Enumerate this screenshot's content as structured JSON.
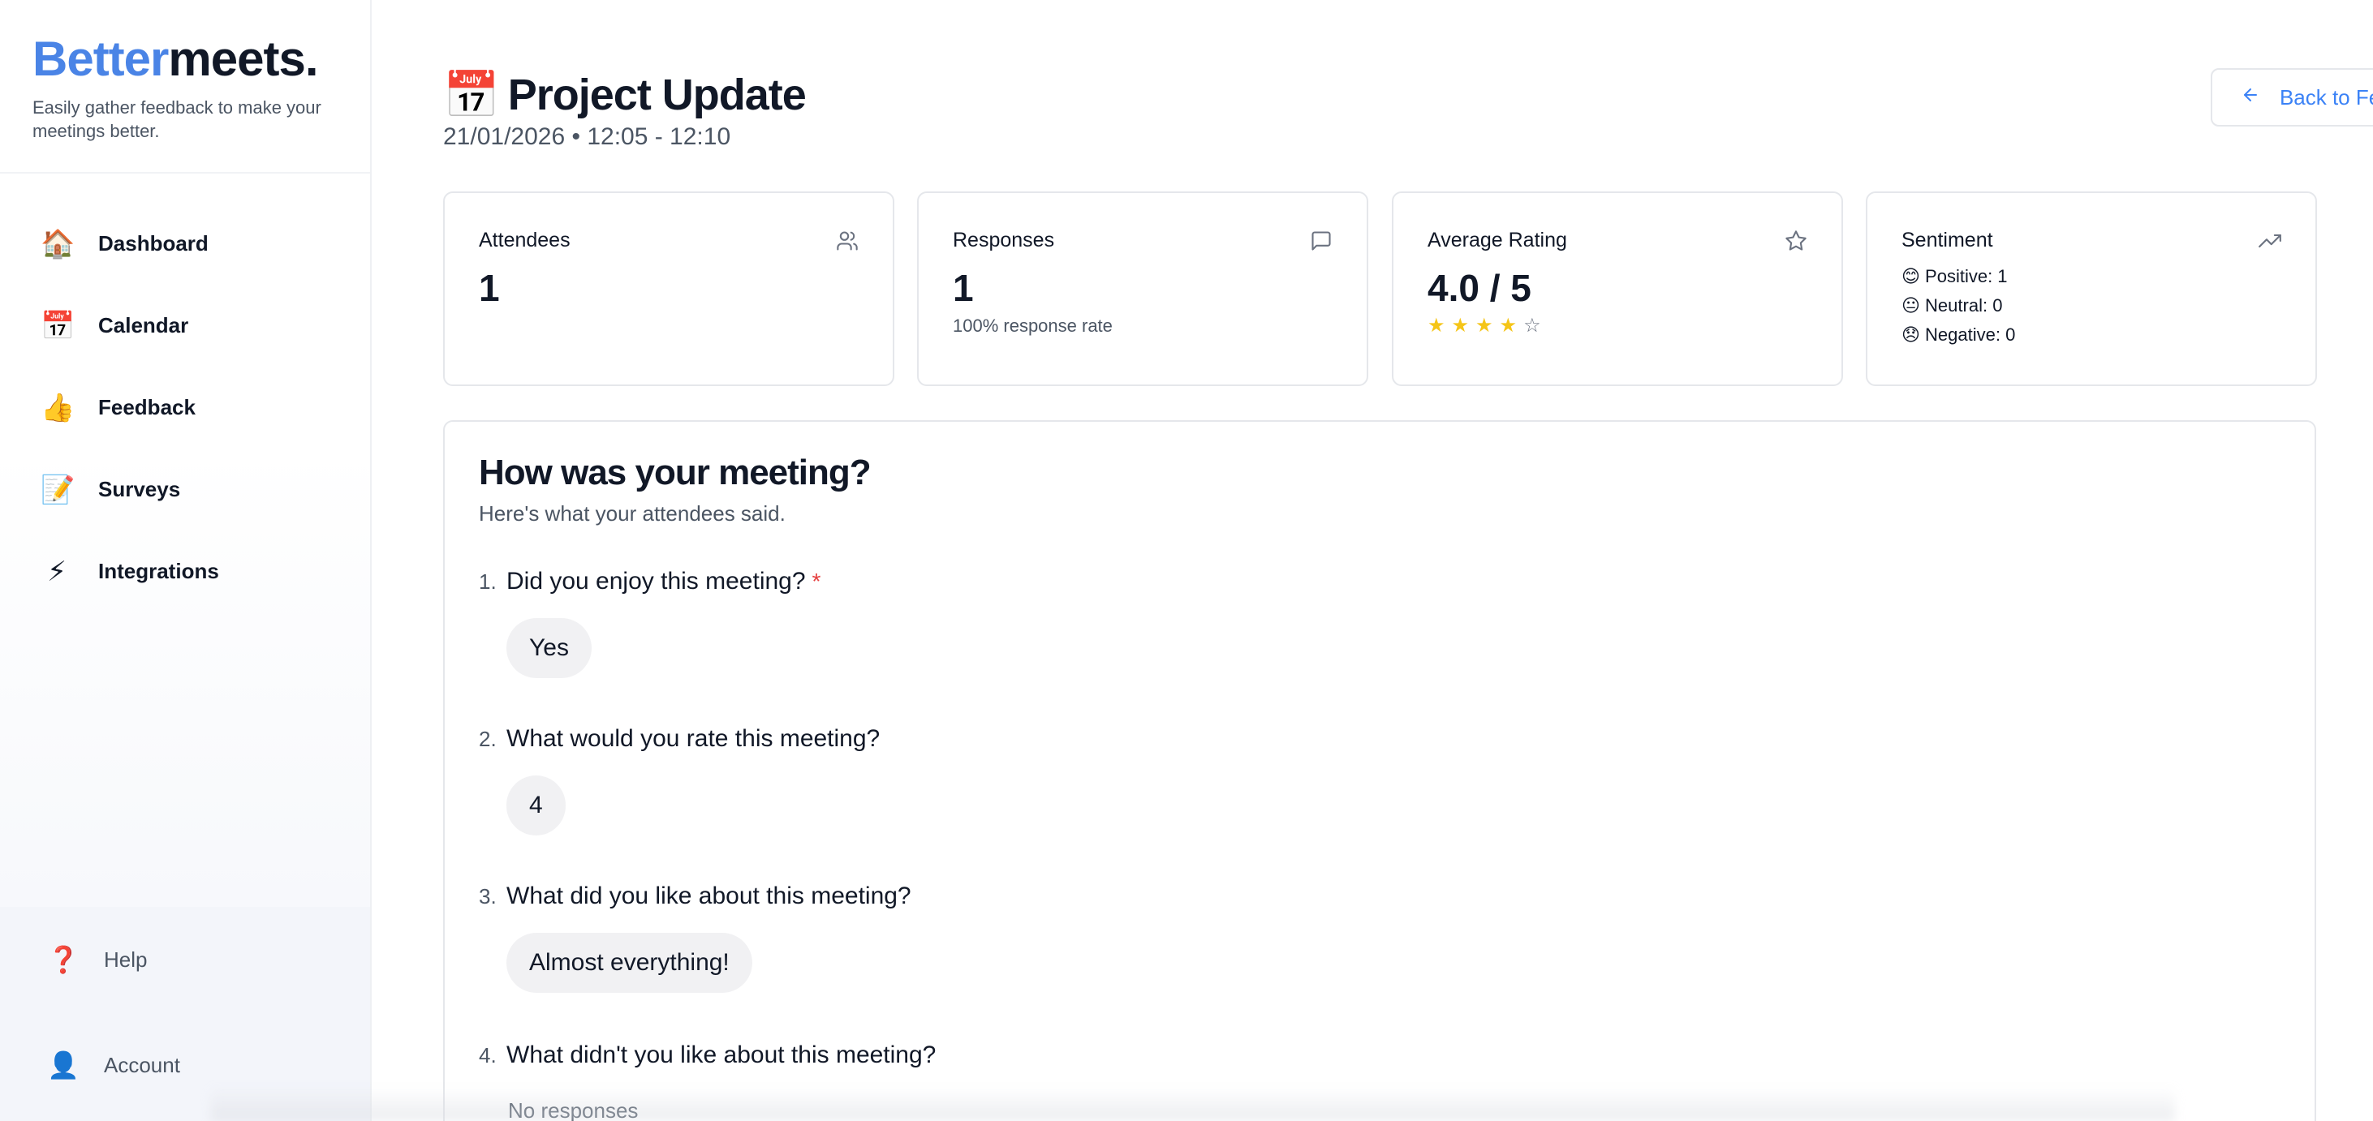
{
  "brand": {
    "part1": "Better",
    "part2": "meets.",
    "tagline": "Easily gather feedback to make your meetings better."
  },
  "nav": {
    "items": [
      {
        "icon": "🏠",
        "label": "Dashboard"
      },
      {
        "icon": "📅",
        "label": "Calendar"
      },
      {
        "icon": "👍",
        "label": "Feedback"
      },
      {
        "icon": "📝",
        "label": "Surveys"
      },
      {
        "icon": "⚡",
        "label": "Integrations"
      }
    ],
    "bottom": [
      {
        "icon": "❓",
        "label": "Help"
      },
      {
        "icon": "👤",
        "label": "Account"
      }
    ]
  },
  "header": {
    "icon": "📅",
    "title": "Project Update",
    "subtitle": "21/01/2026 • 12:05 - 12:10",
    "back_label": "Back to Feedback"
  },
  "cards": {
    "attendees": {
      "title": "Attendees",
      "value": "1",
      "icon": "users-icon"
    },
    "responses": {
      "title": "Responses",
      "value": "1",
      "sub": "100% response rate",
      "icon": "message-icon"
    },
    "rating": {
      "title": "Average Rating",
      "value": "4.0 / 5",
      "rating": 4,
      "max": 5,
      "icon": "star-icon"
    },
    "sentiment": {
      "title": "Sentiment",
      "icon": "trending-up-icon",
      "positive": "😊 Positive: 1",
      "neutral": "😐 Neutral: 0",
      "negative": "😞 Negative: 0"
    }
  },
  "panel": {
    "title": "How was your meeting?",
    "subtitle": "Here's what your attendees said.",
    "questions": [
      {
        "num": "1.",
        "text": "Did you enjoy this meeting?",
        "required": "*",
        "answer": "Yes"
      },
      {
        "num": "2.",
        "text": "What would you rate this meeting?",
        "answer": "4"
      },
      {
        "num": "3.",
        "text": "What did you like about this meeting?",
        "answer": "Almost everything!"
      },
      {
        "num": "4.",
        "text": "What didn't you like about this meeting?",
        "empty": "No responses"
      }
    ]
  },
  "colors": {
    "brand_blue": "#4a84e6",
    "link_blue": "#3b82f6",
    "star_gold": "#f5c518",
    "required_red": "#e53e3e"
  }
}
